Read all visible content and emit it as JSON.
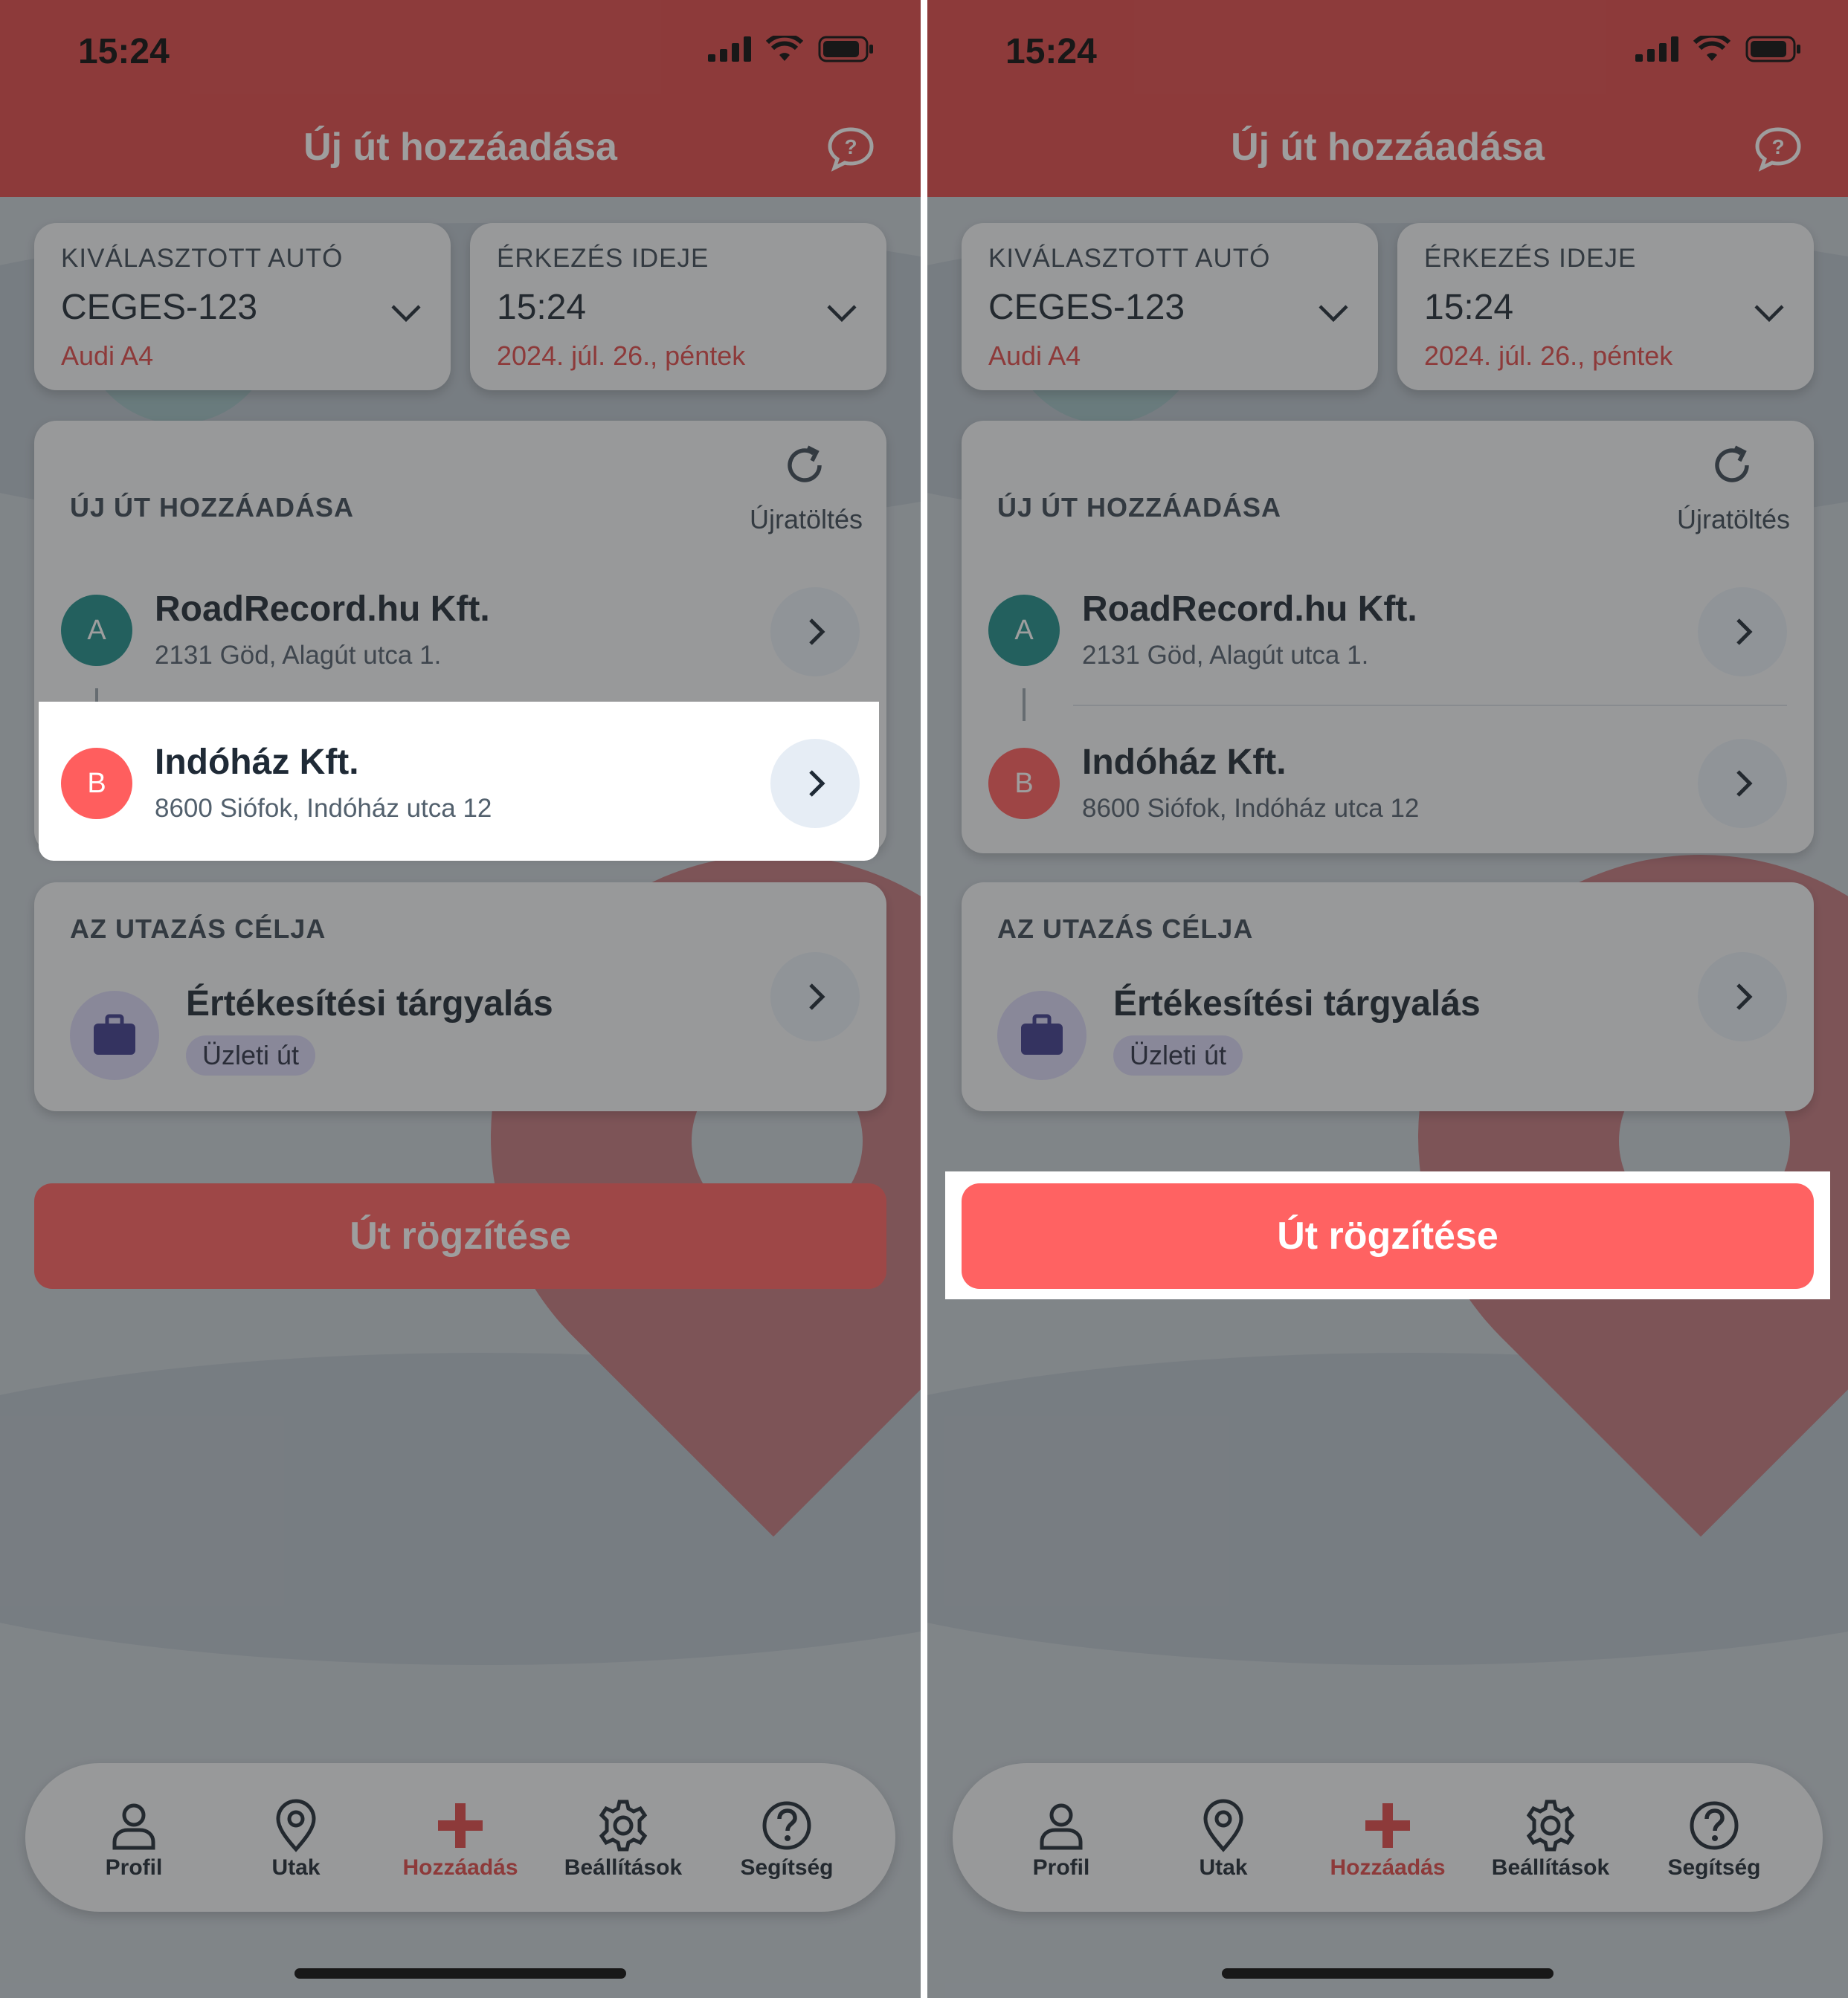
{
  "status": {
    "time": "15:24"
  },
  "header": {
    "title": "Új út hozzáadása"
  },
  "car": {
    "label": "KIVÁLASZTOTT AUTÓ",
    "plate": "CEGES-123",
    "model": "Audi A4"
  },
  "arrival": {
    "label": "ÉRKEZÉS IDEJE",
    "time": "15:24",
    "date": "2024. júl. 26., péntek"
  },
  "route": {
    "section_label": "ÚJ ÚT HOZZÁADÁSA",
    "reload_label": "Újratöltés",
    "stops": [
      {
        "badge": "A",
        "name": "RoadRecord.hu Kft.",
        "address": "2131 Göd, Alagút utca 1."
      },
      {
        "badge": "B",
        "name": "Indóház Kft.",
        "address": "8600 Siófok, Indóház utca 12"
      }
    ]
  },
  "purpose": {
    "section_label": "AZ UTAZÁS CÉLJA",
    "name": "Értékesítési tárgyalás",
    "tag": "Üzleti út",
    "icon": "briefcase-icon"
  },
  "action": {
    "record_label": "Út rögzítése"
  },
  "nav": {
    "items": [
      {
        "label": "Profil",
        "icon": "person-icon"
      },
      {
        "label": "Utak",
        "icon": "location-pin-icon"
      },
      {
        "label": "Hozzáadás",
        "icon": "plus-icon"
      },
      {
        "label": "Beállítások",
        "icon": "gear-icon"
      },
      {
        "label": "Segítség",
        "icon": "question-circle-icon"
      }
    ]
  },
  "colors": {
    "brand": "#e04a4a",
    "accent": "#ff6262",
    "badge_a": "#1f8f8b",
    "badge_b": "#ff5e5e",
    "purpose": "#3f3d8f"
  }
}
